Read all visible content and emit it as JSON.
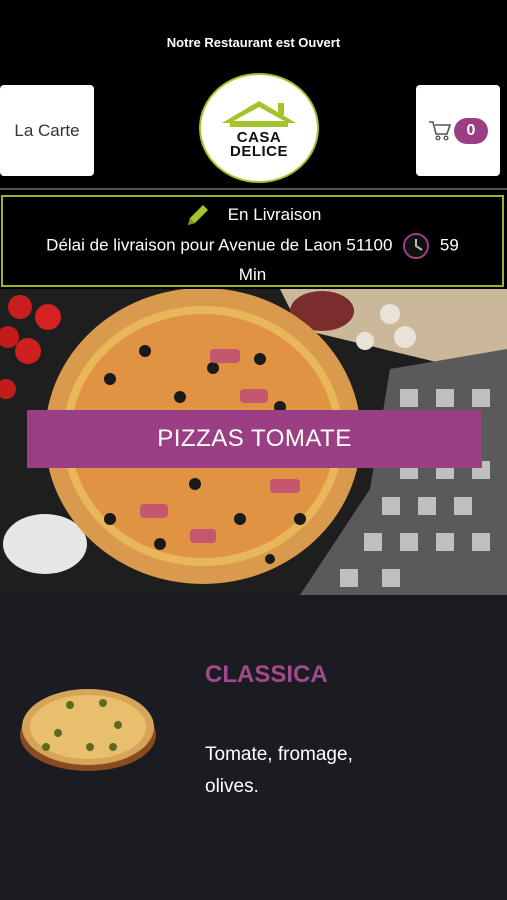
{
  "status": {
    "text": "Notre Restaurant est Ouvert"
  },
  "header": {
    "menu_label": "La Carte",
    "logo_line1": "CASA",
    "logo_line2": "DELICE",
    "cart_count": "0"
  },
  "delivery": {
    "mode": "En Livraison",
    "detail": "Délai de livraison pour Avenue de Laon 51100",
    "time_value": "59",
    "time_unit": "Min"
  },
  "category": {
    "title": "PIZZAS TOMATE"
  },
  "product": {
    "name": "CLASSICA",
    "description": "Tomate, fromage, olives."
  },
  "colors": {
    "accent": "#9b3f84",
    "logo_green": "#a3c42a",
    "border_green": "#9ab22b",
    "product_bg": "#1b1c22"
  }
}
